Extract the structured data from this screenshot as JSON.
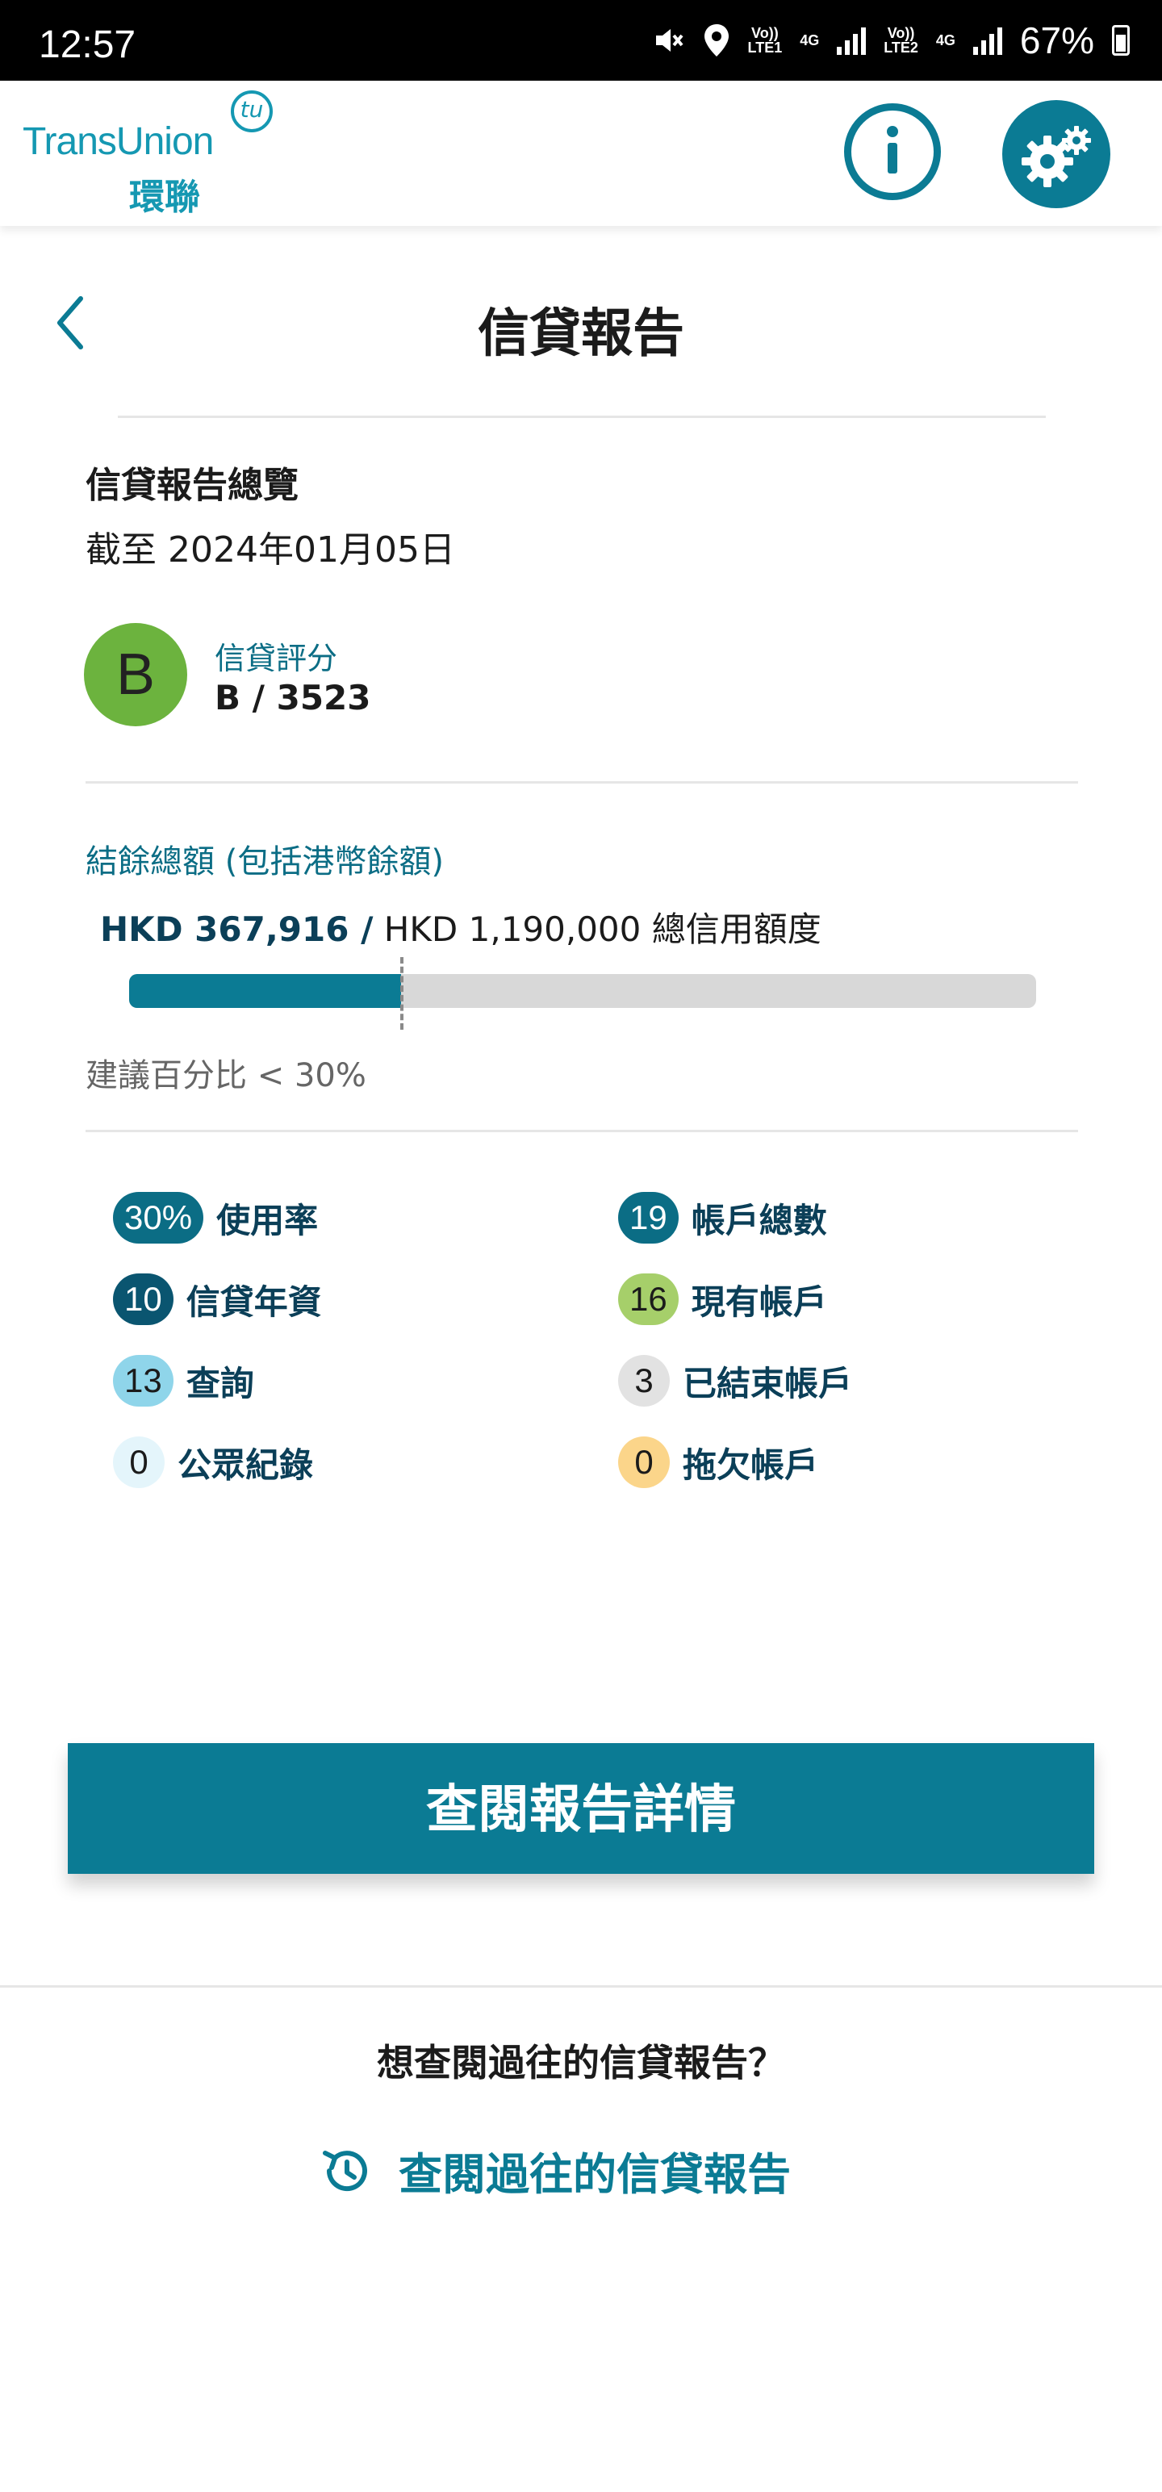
{
  "status_bar": {
    "time": "12:57",
    "sim1": [
      "Vo))",
      "LTE1"
    ],
    "sim1_net": "4G",
    "sim2": [
      "Vo))",
      "LTE2"
    ],
    "sim2_net": "4G",
    "battery": "67%"
  },
  "header": {
    "logo_text": "TransUnion",
    "logo_cn": "環聯",
    "logo_tu": "tu"
  },
  "page": {
    "title": "信貸報告"
  },
  "summary": {
    "title": "信貸報告總覽",
    "date": "截至  2024年01月05日",
    "grade_letter": "B",
    "grade_label": "信貸評分",
    "grade_value": "B / 3523"
  },
  "balance": {
    "label": "結餘總額 (包括港幣餘額)",
    "amount": "HKD 367,916 /",
    "limit": " HKD 1,190,000 總信用額度",
    "utilization": 0.3,
    "note": "建議百分比 < 30%"
  },
  "stats": [
    {
      "value": "30%",
      "label": "使用率",
      "bg": "#0b6d85",
      "fg": "#ffffff"
    },
    {
      "value": "19",
      "label": "帳戶總數",
      "bg": "#0b6d85",
      "fg": "#ffffff"
    },
    {
      "value": "10",
      "label": "信貸年資",
      "bg": "#0a5570",
      "fg": "#ffffff"
    },
    {
      "value": "16",
      "label": "現有帳戶",
      "bg": "#a6cf6a",
      "fg": "#1b1b1b"
    },
    {
      "value": "13",
      "label": "查詢",
      "bg": "#8fd5ea",
      "fg": "#1b1b1b"
    },
    {
      "value": "3",
      "label": "已結束帳戶",
      "bg": "#e2e2e2",
      "fg": "#1b1b1b"
    },
    {
      "value": "0",
      "label": "公眾紀錄",
      "bg": "#e4f5fb",
      "fg": "#1b1b1b"
    },
    {
      "value": "0",
      "label": "拖欠帳戶",
      "bg": "#fbd58a",
      "fg": "#1b1b1b"
    }
  ],
  "cta": {
    "label": "查閱報告詳情"
  },
  "past": {
    "question": "想查閱過往的信貸報告？",
    "link": "查閱過往的信貸報告"
  },
  "colors": {
    "accent": "#0b7b94",
    "brand": "#1598b2",
    "grade": "#6cb33e"
  },
  "icons": {
    "back": "chevron-left-icon",
    "info": "info-icon",
    "settings": "gear-icon",
    "history": "history-icon"
  }
}
